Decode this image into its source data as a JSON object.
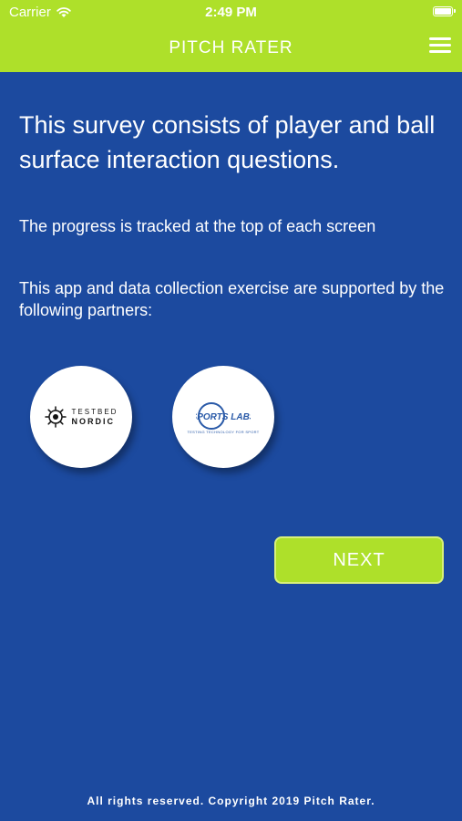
{
  "status_bar": {
    "carrier": "Carrier",
    "time": "2:49 PM"
  },
  "header": {
    "title": "PITCH RATER"
  },
  "content": {
    "headline": "This survey consists of player and ball surface interaction questions.",
    "progress_note": "The progress is tracked at the top of each screen",
    "partners_intro": "This app and data collection exercise are supported by the following partners:"
  },
  "partners": [
    {
      "name_line1": "TESTBED",
      "name_line2": "NORDIC"
    },
    {
      "name": "SPORTS LABS",
      "tagline": "TESTING TECHNOLOGY FOR SPORT"
    }
  ],
  "actions": {
    "next_label": "NEXT"
  },
  "footer": {
    "copyright": "All rights reserved. Copyright 2019 Pitch Rater."
  },
  "colors": {
    "background": "#1c4a9f",
    "accent": "#aee02a",
    "text": "#ffffff"
  }
}
